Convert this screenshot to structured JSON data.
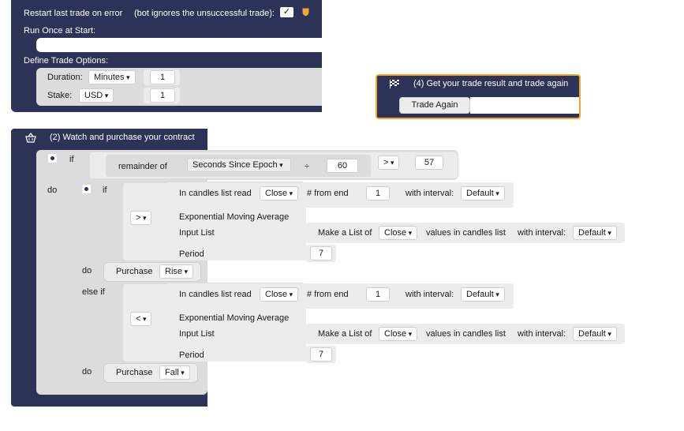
{
  "block1": {
    "restart_error_label": "Restart last trade on error",
    "restart_error_note": "(bot ignores the unsuccessful trade):",
    "restart_error_checked": true,
    "run_once_label": "Run Once at Start:",
    "define_trade_options_label": "Define Trade Options:",
    "duration_label": "Duration:",
    "duration_unit": "Minutes",
    "duration_value": "1",
    "stake_label": "Stake:",
    "currency": "USD",
    "stake_value": "1"
  },
  "block4": {
    "title": "(4) Get your trade result and trade again",
    "trade_again_label": "Trade Again"
  },
  "block2": {
    "title": "(2) Watch and purchase your contract",
    "if_label": "if",
    "do_label": "do",
    "else_if_label": "else if",
    "remainder_label": "remainder of",
    "seconds_since_epoch": "Seconds Since Epoch",
    "divide_symbol": "÷",
    "divisor": "60",
    "compare_op": ">",
    "compare_value": "57",
    "inner_if_label": "if",
    "rise": {
      "candles_list_read": "In candles list read",
      "field": "Close",
      "from_end_label": "# from end",
      "from_end_value": "1",
      "with_interval_label": "with interval:",
      "interval": "Default",
      "operator": ">",
      "ema_label": "Exponential Moving Average",
      "input_list_label": "Input List",
      "make_list_label": "Make a List of",
      "list_field": "Close",
      "values_label": "values in candles list",
      "with_interval_label_2": "with interval:",
      "list_interval": "Default",
      "period_label": "Period",
      "period_value": "7",
      "do_label": "do",
      "purchase_label": "Purchase",
      "contract": "Rise"
    },
    "fall": {
      "else_if_label": "else if",
      "candles_list_read": "In candles list read",
      "field": "Close",
      "from_end_label": "# from end",
      "from_end_value": "1",
      "with_interval_label": "with interval:",
      "interval": "Default",
      "operator": "<",
      "ema_label": "Exponential Moving Average",
      "input_list_label": "Input List",
      "make_list_label": "Make a List of",
      "list_field": "Close",
      "values_label": "values in candles list",
      "with_interval_label_2": "with interval:",
      "list_interval": "Default",
      "period_label": "Period",
      "period_value": "7",
      "do_label": "do",
      "purchase_label": "Purchase",
      "contract": "Fall"
    }
  },
  "colors": {
    "navy": "#2c3356",
    "block_gray": "#dcdcdc",
    "accent_orange": "#f0a830"
  },
  "icons": {
    "flag": "checkered-flag-icon",
    "basket": "basket-icon",
    "gear": "gear-icon",
    "check": "check-icon",
    "shield": "shield-icon"
  }
}
